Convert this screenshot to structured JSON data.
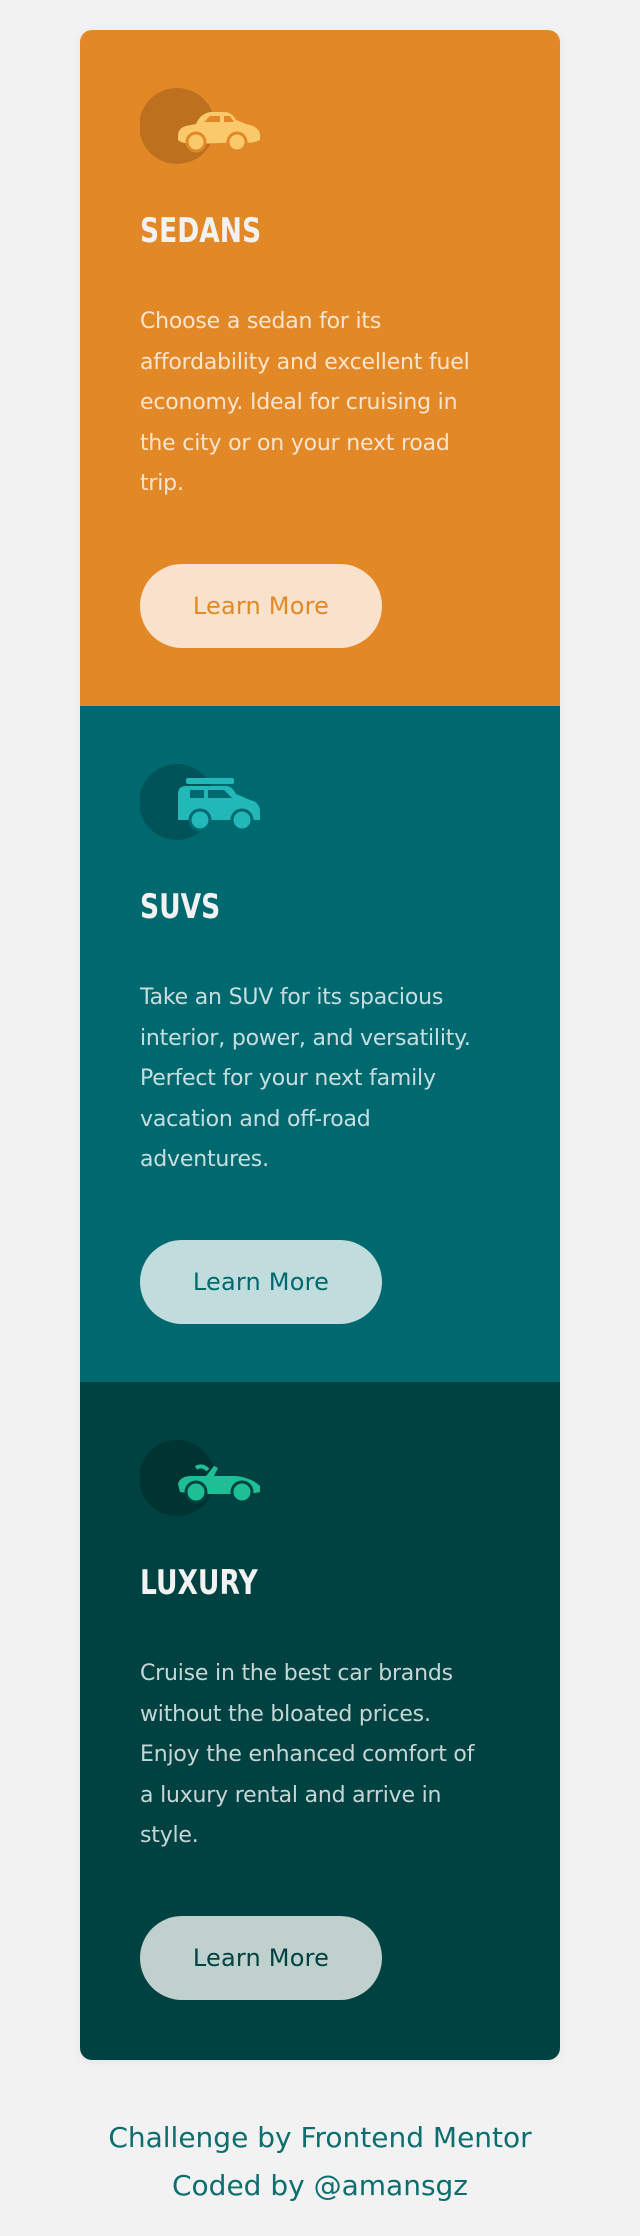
{
  "cards": [
    {
      "title": "Sedans",
      "description": "Choose a sedan for its affordability and excellent fuel economy. Ideal for cruising in the city or on your next road trip.",
      "button_label": "Learn More",
      "icon": "sedan-car-icon",
      "colors": {
        "background": "#e38826",
        "button_bg": "#f9e2cc",
        "button_text": "#e38826",
        "icon": "#f9c96b"
      }
    },
    {
      "title": "SUVs",
      "description": "Take an SUV for its spacious interior, power, and versatility. Perfect for your next family vacation and off-road adventures.",
      "button_label": "Learn More",
      "icon": "suv-car-icon",
      "colors": {
        "background": "#006970",
        "button_bg": "#c0dcdc",
        "button_text": "#006970",
        "icon": "#22b8b8"
      }
    },
    {
      "title": "Luxury",
      "description": "Cruise in the best car brands without the bloated prices. Enjoy the enhanced comfort of a luxury rental and arrive in style.",
      "button_label": "Learn More",
      "icon": "luxury-car-icon",
      "colors": {
        "background": "#004241",
        "button_bg": "#bfd0cd",
        "button_text": "#004241",
        "icon": "#1fbf96"
      }
    }
  ],
  "attribution": {
    "line1": "Challenge by Frontend Mentor",
    "line2": "Coded by @amansgz"
  }
}
